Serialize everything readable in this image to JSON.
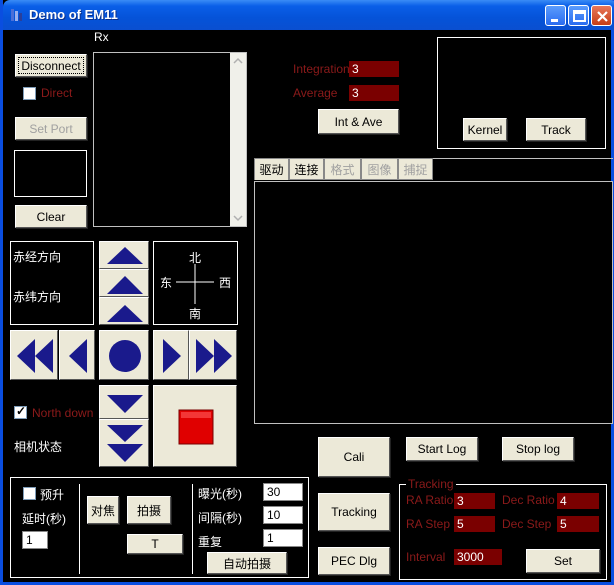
{
  "window": {
    "title": "Demo of EM11"
  },
  "rx": {
    "label": "Rx"
  },
  "connection": {
    "disconnect": "Disconnect",
    "direct": "Direct",
    "set_port": "Set Port",
    "clear": "Clear"
  },
  "integration": {
    "label": "Integration",
    "value": "3",
    "average_label": "Average",
    "average_value": "3",
    "button": "Int & Ave"
  },
  "tracker": {
    "kernel": "Kernel",
    "track": "Track"
  },
  "tabs": [
    {
      "label": "驱动",
      "enabled": true
    },
    {
      "label": "连接",
      "enabled": true
    },
    {
      "label": "格式",
      "enabled": false
    },
    {
      "label": "图像",
      "enabled": false
    },
    {
      "label": "捕捉",
      "enabled": false
    }
  ],
  "direction": {
    "ra": "赤经方向",
    "dec": "赤纬方向"
  },
  "compass": {
    "north": "北",
    "south": "南",
    "east": "东",
    "west": "西"
  },
  "north_down": "North down",
  "camera_status": "相机状态",
  "log": {
    "cali": "Cali",
    "start": "Start Log",
    "stop": "Stop log",
    "tracking": "Tracking",
    "pec": "PEC Dlg"
  },
  "capture": {
    "preheat": "预升",
    "delay_label": "延时(秒)",
    "delay_value": "1",
    "focus": "对焦",
    "shoot": "拍摄",
    "t": "T",
    "exposure_label": "曝光(秒)",
    "exposure_value": "30",
    "interval_label": "间隔(秒)",
    "interval_value": "10",
    "repeat_label": "重复",
    "repeat_value": "1",
    "auto_shoot": "自动拍摄"
  },
  "tracking": {
    "group": "Tracking",
    "ra_ratio_label": "RA Ratio",
    "ra_ratio": "3",
    "dec_ratio_label": "Dec Ratio",
    "dec_ratio": "4",
    "ra_step_label": "RA Step",
    "ra_step": "5",
    "dec_step_label": "Dec Step",
    "dec_step": "5",
    "interval_label": "Interval",
    "interval": "3000",
    "set": "Set"
  },
  "colors": {
    "title_bar": "#0553d8",
    "accent_red": "#8b1a1a",
    "field_red": "#7a0000",
    "arrow_blue": "#1a1a8c",
    "stop_red": "#e00000"
  }
}
